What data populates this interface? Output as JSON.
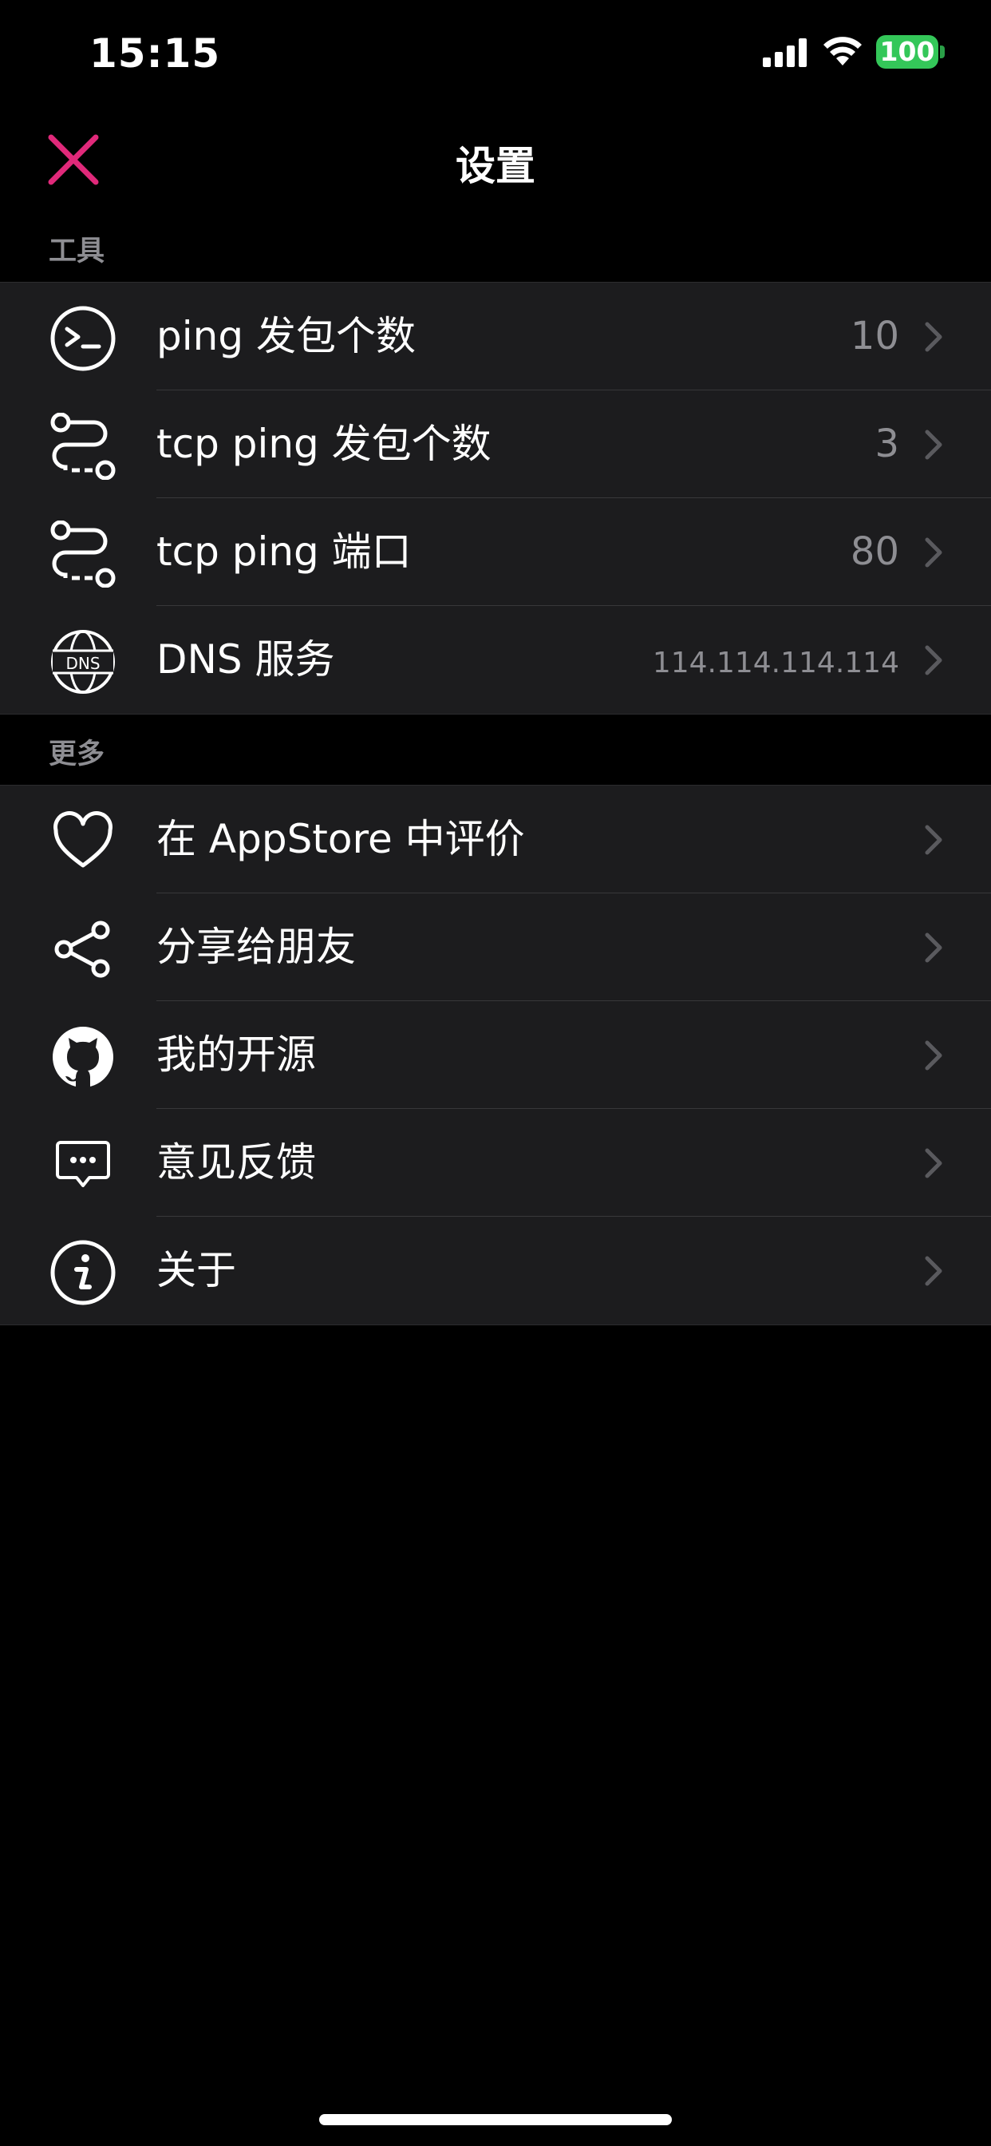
{
  "status_bar": {
    "time": "15:15",
    "battery": "100"
  },
  "nav": {
    "title": "设置"
  },
  "sections": [
    {
      "header": "工具",
      "rows": [
        {
          "icon": "terminal-icon",
          "label": "ping 发包个数",
          "value": "10"
        },
        {
          "icon": "route-icon",
          "label": "tcp ping 发包个数",
          "value": "3"
        },
        {
          "icon": "route-icon",
          "label": "tcp ping 端口",
          "value": "80"
        },
        {
          "icon": "dns-globe-icon",
          "label": "DNS 服务",
          "value": "114.114.114.114"
        }
      ]
    },
    {
      "header": "更多",
      "rows": [
        {
          "icon": "heart-icon",
          "label": "在 AppStore 中评价",
          "value": ""
        },
        {
          "icon": "share-icon",
          "label": "分享给朋友",
          "value": ""
        },
        {
          "icon": "github-icon",
          "label": "我的开源",
          "value": ""
        },
        {
          "icon": "chat-bubble-icon",
          "label": "意见反馈",
          "value": ""
        },
        {
          "icon": "info-icon",
          "label": "关于",
          "value": ""
        }
      ]
    }
  ],
  "colors": {
    "background": "#000000",
    "cell": "#1c1c1e",
    "accent_close": "#e0297a",
    "secondary_text": "#8e8e93",
    "battery": "#34c759"
  }
}
